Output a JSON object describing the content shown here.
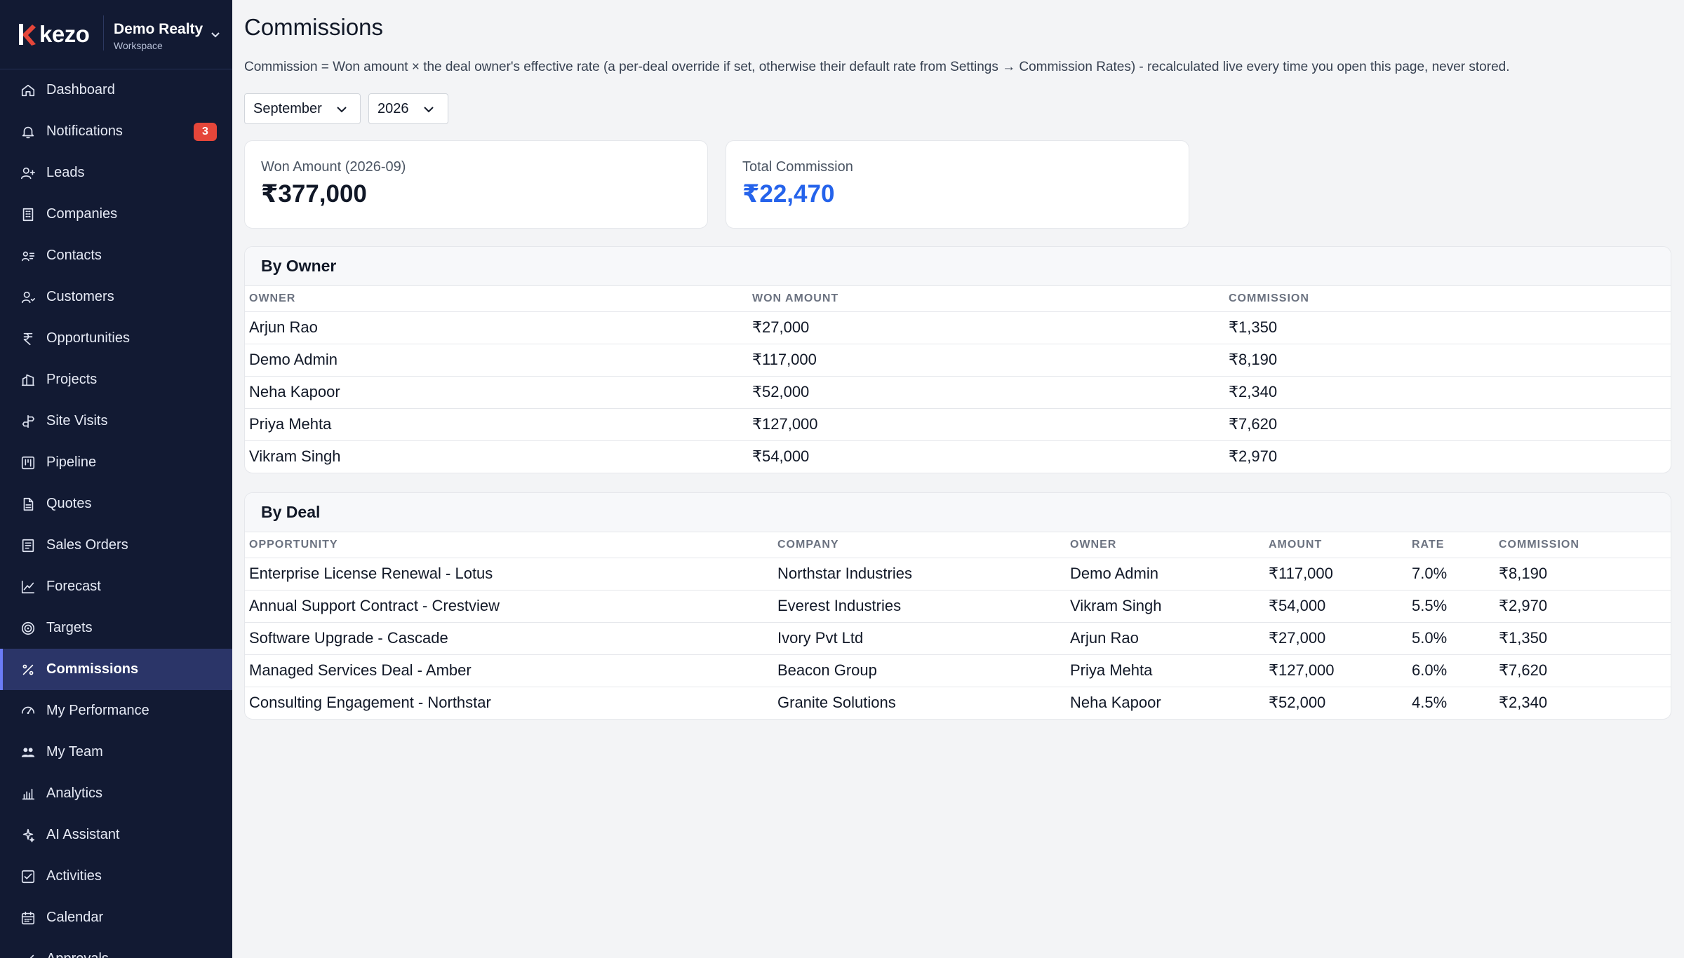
{
  "brand": {
    "logo": "kezo",
    "workspace_name": "Demo Realty",
    "workspace_sub": "Workspace"
  },
  "colors": {
    "sidebar": "#121a33",
    "active": "#2b3568",
    "accent": "#2563eb",
    "badge": "#e5463a"
  },
  "nav": [
    {
      "label": "Dashboard",
      "icon": "home-icon"
    },
    {
      "label": "Notifications",
      "icon": "bell-icon",
      "badge": "3"
    },
    {
      "label": "Leads",
      "icon": "user-plus-icon"
    },
    {
      "label": "Companies",
      "icon": "building-icon"
    },
    {
      "label": "Contacts",
      "icon": "contacts-icon"
    },
    {
      "label": "Customers",
      "icon": "customer-icon"
    },
    {
      "label": "Opportunities",
      "icon": "rupee-icon"
    },
    {
      "label": "Projects",
      "icon": "projects-icon"
    },
    {
      "label": "Site Visits",
      "icon": "signpost-icon"
    },
    {
      "label": "Pipeline",
      "icon": "kanban-icon"
    },
    {
      "label": "Quotes",
      "icon": "document-icon"
    },
    {
      "label": "Sales Orders",
      "icon": "receipt-icon"
    },
    {
      "label": "Forecast",
      "icon": "trend-icon"
    },
    {
      "label": "Targets",
      "icon": "target-icon"
    },
    {
      "label": "Commissions",
      "icon": "percent-icon",
      "active": true
    },
    {
      "label": "My Performance",
      "icon": "gauge-icon"
    },
    {
      "label": "My Team",
      "icon": "team-icon"
    },
    {
      "label": "Analytics",
      "icon": "bar-chart-icon"
    },
    {
      "label": "AI Assistant",
      "icon": "sparkles-icon"
    },
    {
      "label": "Activities",
      "icon": "checklist-icon"
    },
    {
      "label": "Calendar",
      "icon": "calendar-icon"
    },
    {
      "label": "Approvals",
      "icon": "approvals-icon"
    }
  ],
  "page": {
    "title": "Commissions",
    "description": "Commission = Won amount × the deal owner's effective rate (a per-deal override if set, otherwise their default rate from Settings → Commission Rates) - recalculated live every time you open this page, never stored."
  },
  "filters": {
    "month": "September",
    "year": "2026"
  },
  "summary": {
    "won_label": "Won Amount (2026-09)",
    "won_value": "₹377,000",
    "commission_label": "Total Commission",
    "commission_value": "₹22,470"
  },
  "by_owner": {
    "title": "By Owner",
    "columns": [
      "OWNER",
      "WON AMOUNT",
      "COMMISSION"
    ],
    "rows": [
      [
        "Arjun Rao",
        "₹27,000",
        "₹1,350"
      ],
      [
        "Demo Admin",
        "₹117,000",
        "₹8,190"
      ],
      [
        "Neha Kapoor",
        "₹52,000",
        "₹2,340"
      ],
      [
        "Priya Mehta",
        "₹127,000",
        "₹7,620"
      ],
      [
        "Vikram Singh",
        "₹54,000",
        "₹2,970"
      ]
    ]
  },
  "by_deal": {
    "title": "By Deal",
    "columns": [
      "OPPORTUNITY",
      "COMPANY",
      "OWNER",
      "AMOUNT",
      "RATE",
      "COMMISSION"
    ],
    "rows": [
      [
        "Enterprise License Renewal - Lotus",
        "Northstar Industries",
        "Demo Admin",
        "₹117,000",
        "7.0%",
        "₹8,190"
      ],
      [
        "Annual Support Contract - Crestview",
        "Everest Industries",
        "Vikram Singh",
        "₹54,000",
        "5.5%",
        "₹2,970"
      ],
      [
        "Software Upgrade - Cascade",
        "Ivory Pvt Ltd",
        "Arjun Rao",
        "₹27,000",
        "5.0%",
        "₹1,350"
      ],
      [
        "Managed Services Deal - Amber",
        "Beacon Group",
        "Priya Mehta",
        "₹127,000",
        "6.0%",
        "₹7,620"
      ],
      [
        "Consulting Engagement - Northstar",
        "Granite Solutions",
        "Neha Kapoor",
        "₹52,000",
        "4.5%",
        "₹2,340"
      ]
    ]
  }
}
